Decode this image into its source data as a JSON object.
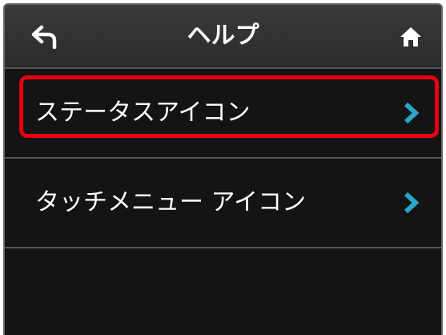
{
  "header": {
    "title": "ヘルプ",
    "back_icon": "back-arrow-icon",
    "home_icon": "home-icon"
  },
  "menu": {
    "items": [
      {
        "label": "ステータスアイコン",
        "icon": "chevron-right-icon",
        "highlighted": true
      },
      {
        "label": "タッチメニュー アイコン",
        "icon": "chevron-right-icon",
        "highlighted": false
      }
    ]
  },
  "colors": {
    "background": "#141414",
    "header": "#333333",
    "text": "#ffffff",
    "chevron": "#2aa6c9",
    "highlight": "#e60012"
  }
}
